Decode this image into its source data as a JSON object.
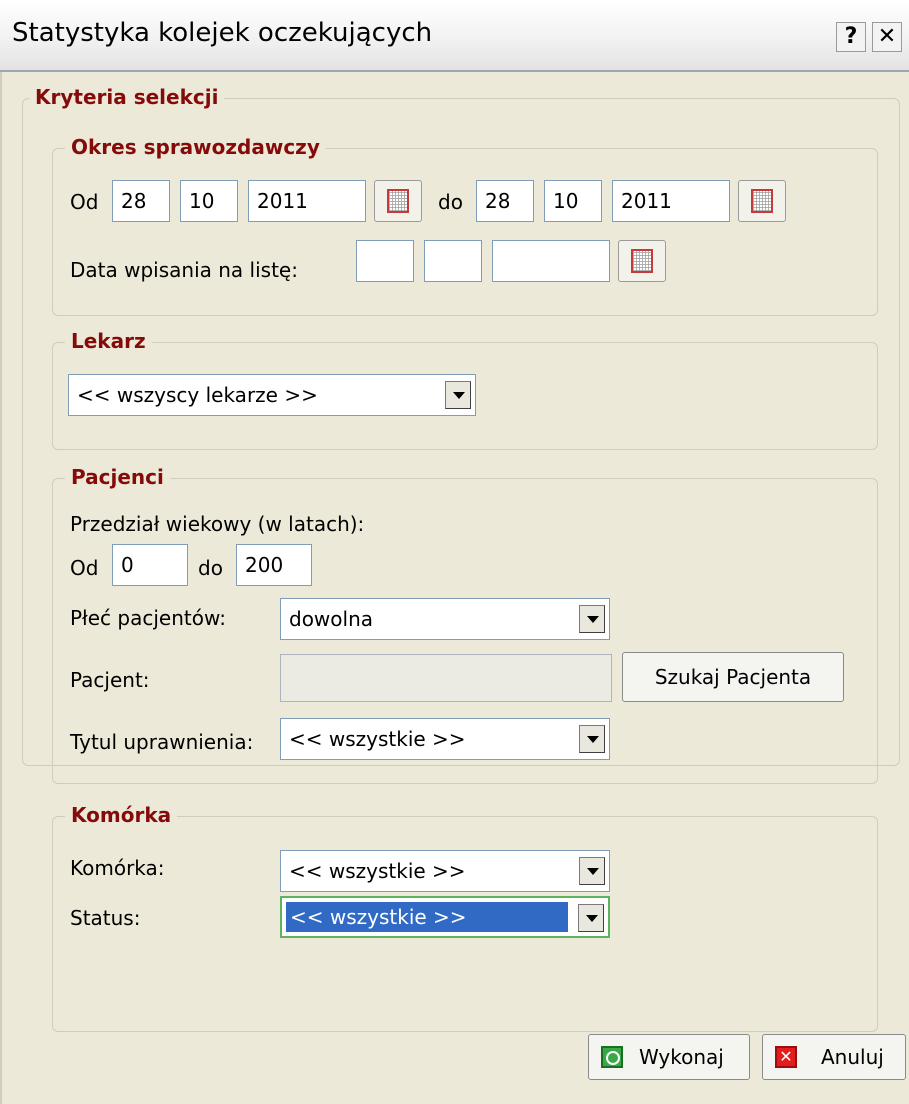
{
  "window": {
    "title": "Statystyka kolejek oczekujących",
    "help_label": "?",
    "close_label": "✕"
  },
  "selection": {
    "legend": "Kryteria selekcji"
  },
  "period": {
    "legend": "Okres sprawozdawczy",
    "from_label": "Od",
    "from_day": "28",
    "from_month": "10",
    "from_year": "2011",
    "to_label": "do",
    "to_day": "28",
    "to_month": "10",
    "to_year": "2011",
    "entry_date_label": "Data wpisania na listę:",
    "entry_day": "",
    "entry_month": "",
    "entry_year": ""
  },
  "doctor": {
    "legend": "Lekarz",
    "selected": "<< wszyscy lekarze >>"
  },
  "patients": {
    "legend": "Pacjenci",
    "age_range_label": "Przedział wiekowy (w latach):",
    "age_from_label": "Od",
    "age_from": "0",
    "age_to_label": "do",
    "age_to": "200",
    "sex_label": "Płeć pacjentów:",
    "sex_selected": "dowolna",
    "patient_label": "Pacjent:",
    "patient_value": "",
    "search_button": "Szukaj Pacjenta",
    "entitlement_label": "Tytul uprawnienia:",
    "entitlement_selected": "<< wszystkie >>"
  },
  "unit": {
    "legend": "Komórka",
    "unit_label": "Komórka:",
    "unit_selected": "<< wszystkie >>",
    "status_label": "Status:",
    "status_selected": "<< wszystkie >>"
  },
  "footer": {
    "execute_label": "Wykonaj",
    "cancel_label": "Anuluj"
  },
  "colors": {
    "legend_text": "#850b0b",
    "dialog_bg": "#ece9d8",
    "selection_highlight": "#316ac5"
  }
}
